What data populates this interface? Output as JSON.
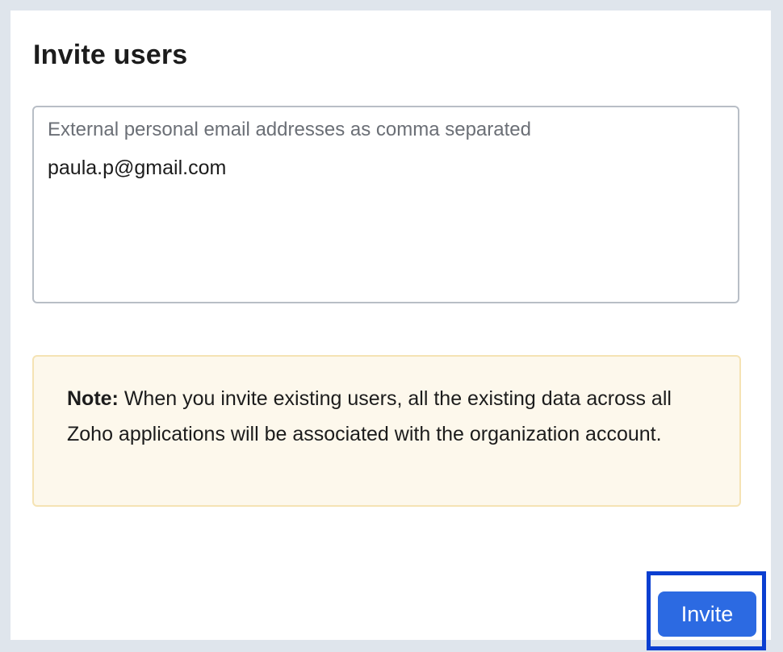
{
  "dialog": {
    "title": "Invite users"
  },
  "email_input": {
    "placeholder": "External personal email addresses as comma separated",
    "value": "paula.p@gmail.com"
  },
  "note": {
    "label": "Note:",
    "text": " When you invite existing users, all the existing data across all Zoho applications will be associated with the organization account."
  },
  "actions": {
    "invite_label": "Invite"
  },
  "colors": {
    "primary_button": "#2c6ae2",
    "highlight_border": "#0b3fd1",
    "note_background": "#fdf8ec",
    "note_border": "#f5e3b4"
  }
}
